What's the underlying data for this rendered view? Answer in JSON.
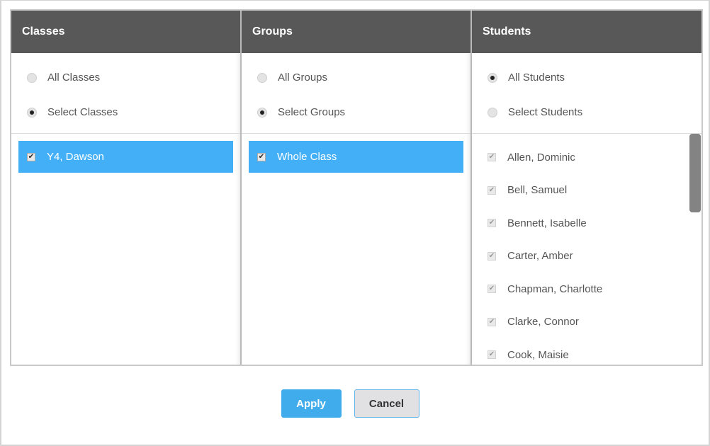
{
  "classes": {
    "header": "Classes",
    "radio_options": [
      {
        "label": "All Classes",
        "selected": false
      },
      {
        "label": "Select Classes",
        "selected": true
      }
    ],
    "items": [
      {
        "label": "Y4, Dawson",
        "checked": true,
        "highlighted": true
      }
    ]
  },
  "groups": {
    "header": "Groups",
    "radio_options": [
      {
        "label": "All Groups",
        "selected": false
      },
      {
        "label": "Select Groups",
        "selected": true
      }
    ],
    "items": [
      {
        "label": "Whole Class",
        "checked": true,
        "highlighted": true
      }
    ]
  },
  "students": {
    "header": "Students",
    "radio_options": [
      {
        "label": "All Students",
        "selected": true
      },
      {
        "label": "Select Students",
        "selected": false
      }
    ],
    "items": [
      {
        "label": "Allen, Dominic",
        "checked": true
      },
      {
        "label": "Bell, Samuel",
        "checked": true
      },
      {
        "label": "Bennett, Isabelle",
        "checked": true
      },
      {
        "label": "Carter, Amber",
        "checked": true
      },
      {
        "label": "Chapman, Charlotte",
        "checked": true
      },
      {
        "label": "Clarke, Connor",
        "checked": true
      },
      {
        "label": "Cook, Maisie",
        "checked": true
      }
    ]
  },
  "actions": {
    "apply_label": "Apply",
    "cancel_label": "Cancel"
  },
  "colors": {
    "header_bg": "#585858",
    "selected_item_bg": "#42aff7",
    "apply_bg": "#40aceb",
    "cancel_bg": "#e1e1e3"
  },
  "icons": {
    "check": "✔"
  }
}
